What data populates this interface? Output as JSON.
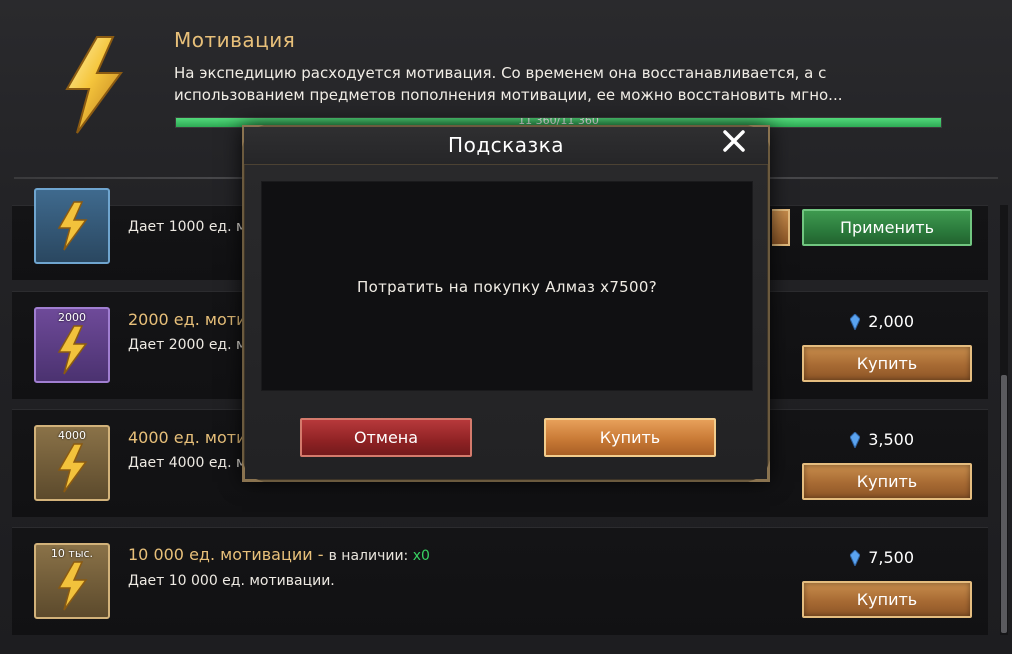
{
  "header": {
    "title": "Мотивация",
    "description": "На экспедицию расходуется мотивация. Со временем она восстанавливается, а с использованием предметов пополнения мотивации, ее можно восстановить мгно...",
    "progress_text": "11 360/11 360",
    "progress_fraction": 1.0,
    "icon": "lightning-bolt-icon"
  },
  "items": [
    {
      "desc": "Дает 1000 ед. м",
      "apply_label": "Применить",
      "box_color": "blue"
    },
    {
      "amount_badge": "2000",
      "title": "2000 ед. моти",
      "desc": "Дает 2000 ед. м",
      "price": "2,000",
      "buy_label": "Купить",
      "box_color": "purple"
    },
    {
      "amount_badge": "4000",
      "title": "4000 ед. моти",
      "desc": "Дает 4000 ед. м",
      "price": "3,500",
      "buy_label": "Купить",
      "box_color": "gold"
    },
    {
      "amount_badge": "10 тыс.",
      "title": "10 000 ед. мотивации",
      "title_sep": " - ",
      "avail_label": "в наличии: ",
      "avail_count": "x0",
      "desc": "Дает 10 000 ед. мотивации.",
      "price": "7,500",
      "buy_label": "Купить",
      "box_color": "gold"
    }
  ],
  "currency_icon": "diamond-icon",
  "modal": {
    "title": "Подсказка",
    "message": "Потратить на покупку Алмаз x7500?",
    "cancel_label": "Отмена",
    "confirm_label": "Купить",
    "close_icon": "close-icon"
  },
  "colors": {
    "accent_gold": "#e8c07a",
    "green": "#38d262",
    "progress": "#3fcf6c"
  }
}
